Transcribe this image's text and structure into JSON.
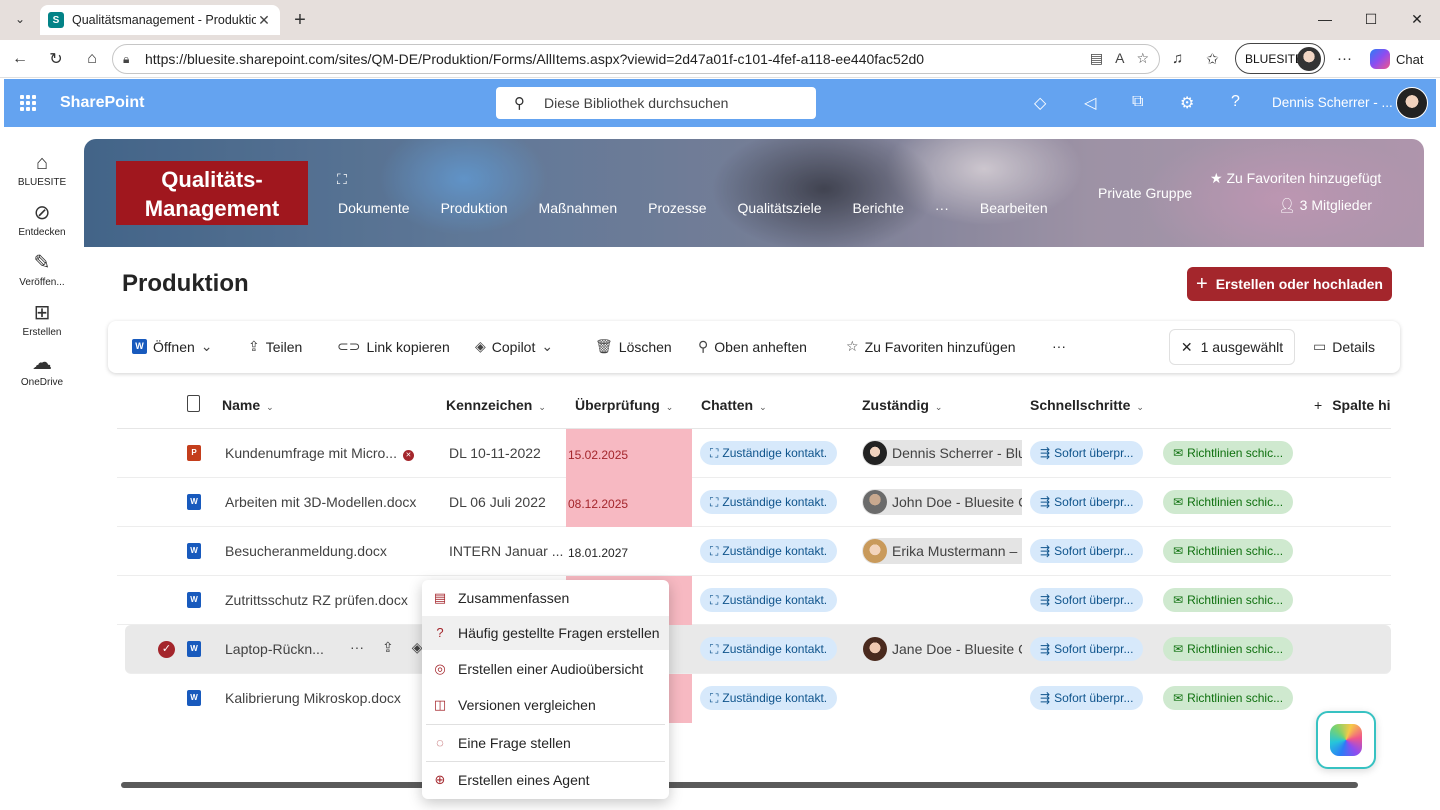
{
  "browser": {
    "tab_title": "Qualitätsmanagement - Produktion",
    "url": "https://bluesite.sharepoint.com/sites/QM-DE/Produktion/Forms/AllItems.aspx?viewid=2d47a01f-c101-4fef-a118-ee440fac52d0",
    "profile_label": "BLUESITE",
    "chat_label": "Chat"
  },
  "suite": {
    "brand": "SharePoint",
    "search_placeholder": "Diese Bibliothek durchsuchen",
    "user_name": "Dennis Scherrer - ..."
  },
  "appbar": {
    "items": [
      {
        "label": "BLUESITE"
      },
      {
        "label": "Entdecken"
      },
      {
        "label": "Veröffen..."
      },
      {
        "label": "Erstellen"
      },
      {
        "label": "OneDrive"
      }
    ]
  },
  "hero": {
    "logo_line1": "Qualitäts-",
    "logo_line2": "Management",
    "nav": [
      "Dokumente",
      "Produktion",
      "Maßnahmen",
      "Prozesse",
      "Qualitätsziele",
      "Berichte",
      "···",
      "Bearbeiten"
    ],
    "private_group": "Private Gruppe",
    "favorite": "Zu Favoriten hinzugefügt",
    "members": "3 Mitglieder"
  },
  "page": {
    "title": "Produktion",
    "create_label": "Erstellen oder hochladen"
  },
  "commands": {
    "open": "Öffnen",
    "share": "Teilen",
    "copy_link": "Link kopieren",
    "copilot": "Copilot",
    "delete": "Löschen",
    "pin": "Oben anheften",
    "favorite": "Zu Favoriten hinzufügen",
    "more": "···",
    "selected": "1 ausgewählt",
    "details": "Details"
  },
  "columns": {
    "name": "Name",
    "kennzeichen": "Kennzeichen",
    "ueberpruefung": "Überprüfung",
    "chatten": "Chatten",
    "zustaendig": "Zuständig",
    "schnellschritte": "Schnellschritte",
    "add_column": "Spalte hi"
  },
  "rows": [
    {
      "name": "Kundenumfrage mit Micro...",
      "kennzeichen": "DL 10-11-2022",
      "date": "15.02.2025",
      "chat": "Zuständige kontakt.",
      "person": "Dennis Scherrer - Blu",
      "quick1": "Sofort überpr...",
      "quick2": "Richtlinien schic..."
    },
    {
      "name": "Arbeiten mit 3D-Modellen.docx",
      "kennzeichen": "DL 06 Juli 2022",
      "date": "08.12.2025",
      "chat": "Zuständige kontakt.",
      "person": "John Doe - Bluesite C",
      "quick1": "Sofort überpr...",
      "quick2": "Richtlinien schic..."
    },
    {
      "name": "Besucheranmeldung.docx",
      "kennzeichen": "INTERN Januar ...",
      "date": "18.01.2027",
      "chat": "Zuständige kontakt.",
      "person": "Erika Mustermann – B",
      "quick1": "Sofort überpr...",
      "quick2": "Richtlinien schic..."
    },
    {
      "name": "Zutrittsschutz RZ prüfen.docx",
      "kennzeichen": "",
      "date": "",
      "chat": "Zuständige kontakt.",
      "person": "",
      "quick1": "Sofort überpr...",
      "quick2": "Richtlinien schic..."
    },
    {
      "name": "Laptop-Rückn...",
      "kennzeichen": "",
      "date": "",
      "chat": "Zuständige kontakt.",
      "person": "Jane Doe - Bluesite C",
      "quick1": "Sofort überpr...",
      "quick2": "Richtlinien schic..."
    },
    {
      "name": "Kalibrierung Mikroskop.docx",
      "kennzeichen": "",
      "date": "",
      "chat": "Zuständige kontakt.",
      "person": "",
      "quick1": "Sofort überpr...",
      "quick2": "Richtlinien schic..."
    }
  ],
  "context_menu": {
    "items": [
      {
        "label": "Zusammenfassen"
      },
      {
        "label": "Häufig gestellte Fragen erstellen"
      },
      {
        "label": "Erstellen einer Audioübersicht"
      },
      {
        "label": "Versionen vergleichen"
      },
      {
        "label": "Eine Frage stellen"
      },
      {
        "label": "Erstellen eines Agent"
      }
    ]
  },
  "colors": {
    "accent": "#a4262c",
    "suitebar": "#64a3f0",
    "overdue": "#f7b9c2"
  }
}
